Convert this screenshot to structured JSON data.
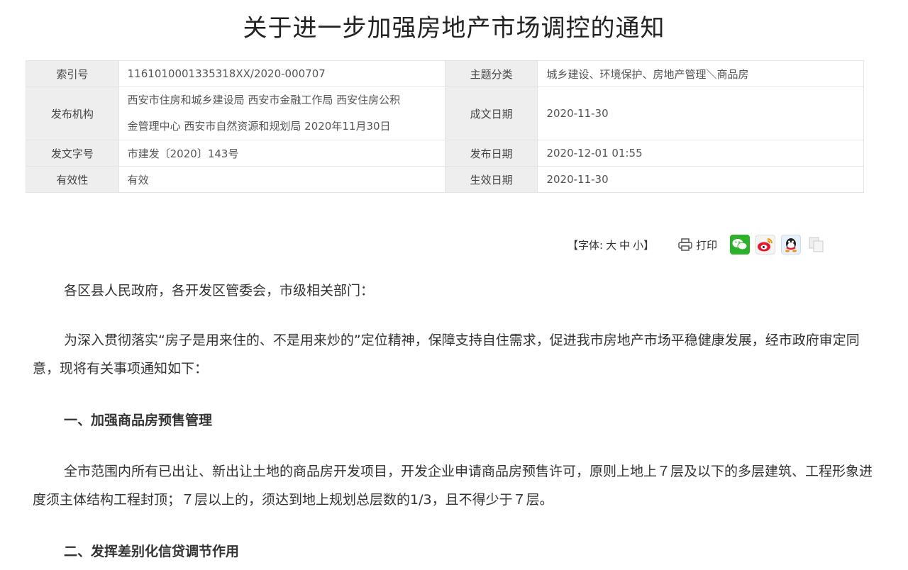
{
  "title": "关于进一步加强房地产市场调控的通知",
  "meta": {
    "index_label": "索引号",
    "index_value": "1161010001335318XX/2020-000707",
    "topic_label": "主题分类",
    "topic_value": "城乡建设、环境保护、房地产管理＼商品房",
    "issuer_label": "发布机构",
    "issuer_line1": "西安市住房和城乡建设局 西安市金融工作局 西安住房公积",
    "issuer_line2": "金管理中心 西安市自然资源和规划局 2020年11月30日",
    "written_label": "成文日期",
    "written_value": "2020-11-30",
    "docno_label": "发文字号",
    "docno_value": "市建发〔2020〕143号",
    "publish_label": "发布日期",
    "publish_value": "2020-12-01 01:55",
    "validity_label": "有效性",
    "validity_value": "有效",
    "effective_label": "生效日期",
    "effective_value": "2020-11-30"
  },
  "toolbar": {
    "font_label": "【字体:",
    "font_large": "大",
    "font_medium": "中",
    "font_small": "小】",
    "print_label": "打印"
  },
  "content": {
    "greeting": "各区县人民政府，各开发区管委会，市级相关部门：",
    "intro": "为深入贯彻落实“房子是用来住的、不是用来炒的”定位精神，保障支持自住需求，促进我市房地产市场平稳健康发展，经市政府审定同意，现将有关事项通知如下：",
    "heading1": "一、加强商品房预售管理",
    "body1": "全市范围内所有已出让、新出让土地的商品房开发项目，开发企业申请商品房预售许可，原则上地上７层及以下的多层建筑、工程形象进度须主体结构工程封顶；７层以上的，须达到地上规划总层数的1/3，且不得少于７层。",
    "heading2": "二、发挥差别化信贷调节作用"
  },
  "icons": {
    "print": "printer-icon",
    "wechat": "wechat-icon",
    "weibo": "weibo-icon",
    "qq": "qq-icon",
    "copy": "copy-icon"
  },
  "colors": {
    "label_bg": "#eeeeee",
    "wechat": "#2bb22a"
  }
}
